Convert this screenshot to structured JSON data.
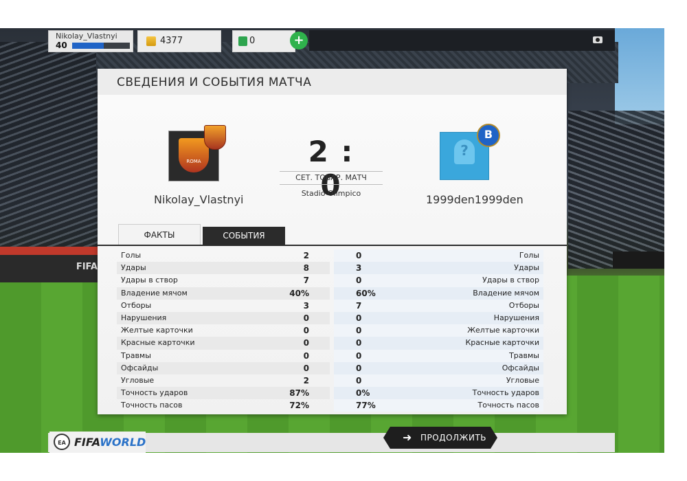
{
  "topbar": {
    "player_name": "Nikolay_Vlastnyi",
    "level": "40",
    "level_progress": 0.55,
    "coins": "4377",
    "fifa_points": "0",
    "plus_label": "+"
  },
  "panel": {
    "title": "СВЕДЕНИЯ И СОБЫТИЯ МАТЧА",
    "home_team": "Nikolay_Vlastnyi",
    "away_team": "1999den1999den",
    "score": "2 : 0",
    "match_type": "СЕТ. ТОВАР. МАТЧ",
    "stadium": "Stadio Olimpico",
    "home_crest_text": "ROMA",
    "away_division_badge": "B",
    "away_avatar_glyph": "?",
    "tabs": {
      "facts": "ФАКТЫ",
      "events": "СОБЫТИЯ"
    }
  },
  "stats": [
    {
      "label": "Голы",
      "home": "2",
      "away": "0"
    },
    {
      "label": "Удары",
      "home": "8",
      "away": "3"
    },
    {
      "label": "Удары в створ",
      "home": "7",
      "away": "0"
    },
    {
      "label": "Владение мячом",
      "home": "40%",
      "away": "60%"
    },
    {
      "label": "Отборы",
      "home": "3",
      "away": "7"
    },
    {
      "label": "Нарушения",
      "home": "0",
      "away": "0"
    },
    {
      "label": "Желтые карточки",
      "home": "0",
      "away": "0"
    },
    {
      "label": "Красные карточки",
      "home": "0",
      "away": "0"
    },
    {
      "label": "Травмы",
      "home": "0",
      "away": "0"
    },
    {
      "label": "Офсайды",
      "home": "0",
      "away": "0"
    },
    {
      "label": "Угловые",
      "home": "2",
      "away": "0"
    },
    {
      "label": "Точность ударов",
      "home": "87%",
      "away": "0%"
    },
    {
      "label": "Точность пасов",
      "home": "72%",
      "away": "77%"
    }
  ],
  "bottom": {
    "ea_label": "EA",
    "logo_fifa": "FIFA",
    "logo_world": "WORLD",
    "continue_arrow": "➜",
    "continue_label": "ПРОДОЛЖИТЬ"
  },
  "stadium_ad": "FIFA"
}
